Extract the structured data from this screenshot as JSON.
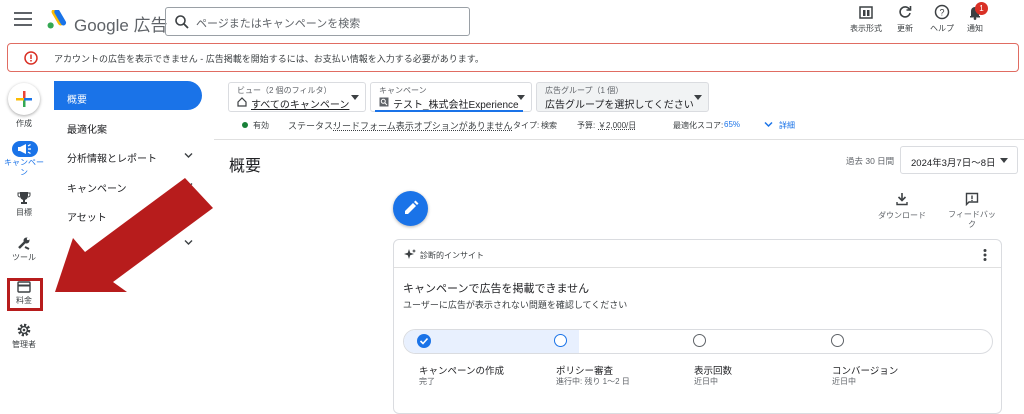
{
  "header": {
    "brand": "Google 広告",
    "search_placeholder": "ページまたはキャンペーンを検索",
    "tools": [
      {
        "label": "表示形式",
        "icon": "view-format-icon"
      },
      {
        "label": "更新",
        "icon": "refresh-icon"
      },
      {
        "label": "ヘルプ",
        "icon": "help-icon"
      },
      {
        "label": "通知",
        "icon": "bell-icon"
      }
    ],
    "notification_count": "1"
  },
  "alert": {
    "text": "アカウントの広告を表示できません - 広告掲載を開始するには、お支払い情報を入力する必要があります。"
  },
  "rail": {
    "create": "作成",
    "campaigns": "キャンペーン",
    "goals": "目標",
    "tools": "ツール",
    "billing": "料金",
    "admin": "管理者"
  },
  "nav": {
    "items": [
      {
        "label": "概要"
      },
      {
        "label": "最適化案"
      },
      {
        "label": "分析情報とレポート"
      },
      {
        "label": "キャンペーン"
      },
      {
        "label": "アセット"
      }
    ]
  },
  "filters": {
    "view_label": "ビュー（2 個のフィルタ）",
    "view_value": "すべてのキャンペーン",
    "campaign_label": "キャンペーン",
    "campaign_value": "テスト_株式会社Experience",
    "adgroup_label": "広告グループ（1 個）",
    "adgroup_value": "広告グループを選択してください"
  },
  "status_line": {
    "state": "有効",
    "status_label": "ステータス:",
    "status_value": "リードフォーム表示オプションがありません",
    "type_label": "タイプ:",
    "type_value": "検索",
    "budget_label": "予算:",
    "budget_value": "￥2,000/日",
    "score_label": "最適化スコア:",
    "score_value": "65%",
    "details": "詳細"
  },
  "page": {
    "title": "概要",
    "period_label": "過去 30 日間",
    "date_range": "2024年3月7日～8日",
    "download": "ダウンロード",
    "feedback_line1": "フィードバッ",
    "feedback_line2": "ク"
  },
  "card": {
    "header": "診断的インサイト",
    "title": "キャンペーンで広告を掲載できません",
    "subtitle": "ユーザーに広告が表示されない問題を確認してください",
    "steps": [
      {
        "title": "キャンペーンの作成",
        "sub": "完了"
      },
      {
        "title": "ポリシー審査",
        "sub": "進行中: 残り 1～2 日"
      },
      {
        "title": "表示回数",
        "sub": "近日中"
      },
      {
        "title": "コンバージョン",
        "sub": "近日中"
      }
    ]
  },
  "colors": {
    "accent": "#1a73e8",
    "alert_border": "#e06c62",
    "arrow": "#b71c1c",
    "active_status": "#188038"
  }
}
